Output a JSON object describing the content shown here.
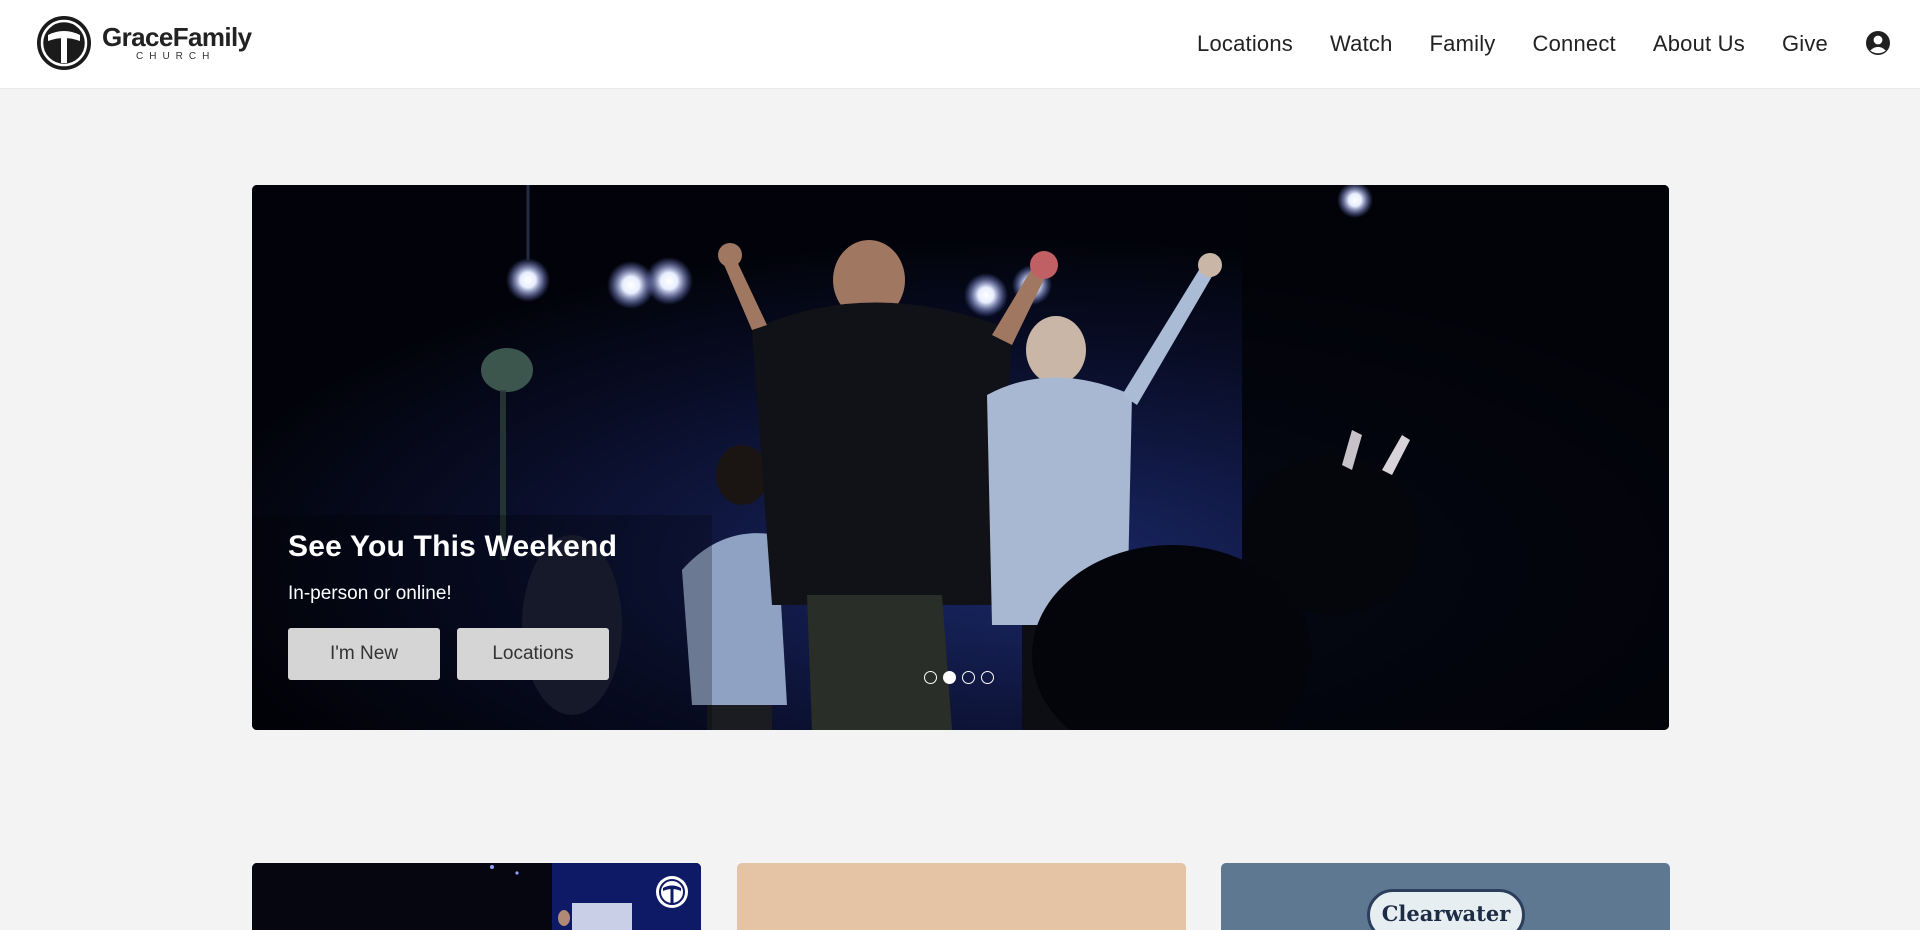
{
  "header": {
    "logo": {
      "name": "GraceFamily",
      "sub": "CHURCH"
    },
    "nav": [
      {
        "label": "Locations"
      },
      {
        "label": "Watch"
      },
      {
        "label": "Family"
      },
      {
        "label": "Connect"
      },
      {
        "label": "About Us"
      },
      {
        "label": "Give"
      }
    ],
    "account_icon": "user-circle-icon"
  },
  "hero": {
    "title": "See You This Weekend",
    "subtitle": "In-person or online!",
    "buttons": [
      {
        "label": "I'm New"
      },
      {
        "label": "Locations"
      }
    ],
    "carousel": {
      "slide_count": 4,
      "active_index": 1
    }
  },
  "cards": [
    {
      "label": ""
    },
    {
      "label": ""
    },
    {
      "label": "Clearwater"
    }
  ],
  "colors": {
    "header_bg": "#ffffff",
    "page_bg": "#f3f3f3",
    "button_bg": "#d5d5d5",
    "card_2_bg": "#e5c3a5",
    "card_3_bg": "#5f7891"
  }
}
